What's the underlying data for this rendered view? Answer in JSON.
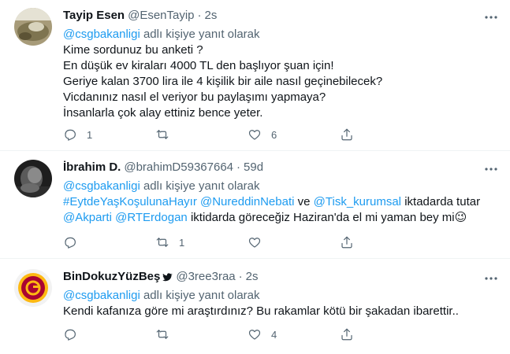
{
  "tweets": [
    {
      "name": "Tayip Esen",
      "handle": "@EsenTayip",
      "dot": "·",
      "time": "2s",
      "reply_to_user": "@csgbakanligi",
      "reply_suffix": "adlı kişiye yanıt olarak",
      "lines": [
        "Kime sordunuz bu anketi ?",
        "En düşük ev kiraları 4000 TL den başlıyor şuan için!",
        "Geriye kalan 3700 lira ile 4 kişilik bir aile nasıl geçinebilecek?",
        "Vicdanınız nasıl el veriyor bu paylaşımı yapmaya?",
        "İnsanlarla çok alay ettiniz bence yeter."
      ],
      "reply_count": "1",
      "retweet_count": "",
      "like_count": "6"
    },
    {
      "name": "İbrahim D.",
      "handle": "@brahimD59367664",
      "dot": "·",
      "time": "59d",
      "reply_to_user": "@csgbakanligi",
      "reply_suffix": "adlı kişiye yanıt olarak",
      "hashtag": "#EytdeYaşKoşulunaHayır",
      "mention1": "@NureddinNebati",
      "connector": "ve",
      "mention2": "@Tisk_kurumsal",
      "text1": "iktadarda tutar",
      "mention3": "@Akparti",
      "mention4": "@RTErdogan",
      "text2": "iktidarda göreceğiz Haziran'da el mi yaman bey mi",
      "emoji": "😉",
      "reply_count": "",
      "retweet_count": "1",
      "like_count": ""
    },
    {
      "name": "BinDokuzYüzBeş",
      "handle": "@3ree3raa",
      "dot": "·",
      "time": "2s",
      "reply_to_user": "@csgbakanligi",
      "reply_suffix": "adlı kişiye yanıt olarak",
      "lines": [
        "Kendi kafanıza göre mi araştırdınız? Bu rakamlar kötü bir şakadan ibarettir.."
      ],
      "reply_count": "",
      "retweet_count": "",
      "like_count": "4"
    }
  ],
  "colors": {
    "link": "#1d9bf0",
    "muted": "#536471",
    "text": "#0f1419",
    "galatasaray_red": "#a90432",
    "galatasaray_yellow": "#fdb912"
  },
  "icons": [
    "more-icon",
    "reply-icon",
    "retweet-icon",
    "like-icon",
    "share-icon",
    "bird-icon"
  ]
}
